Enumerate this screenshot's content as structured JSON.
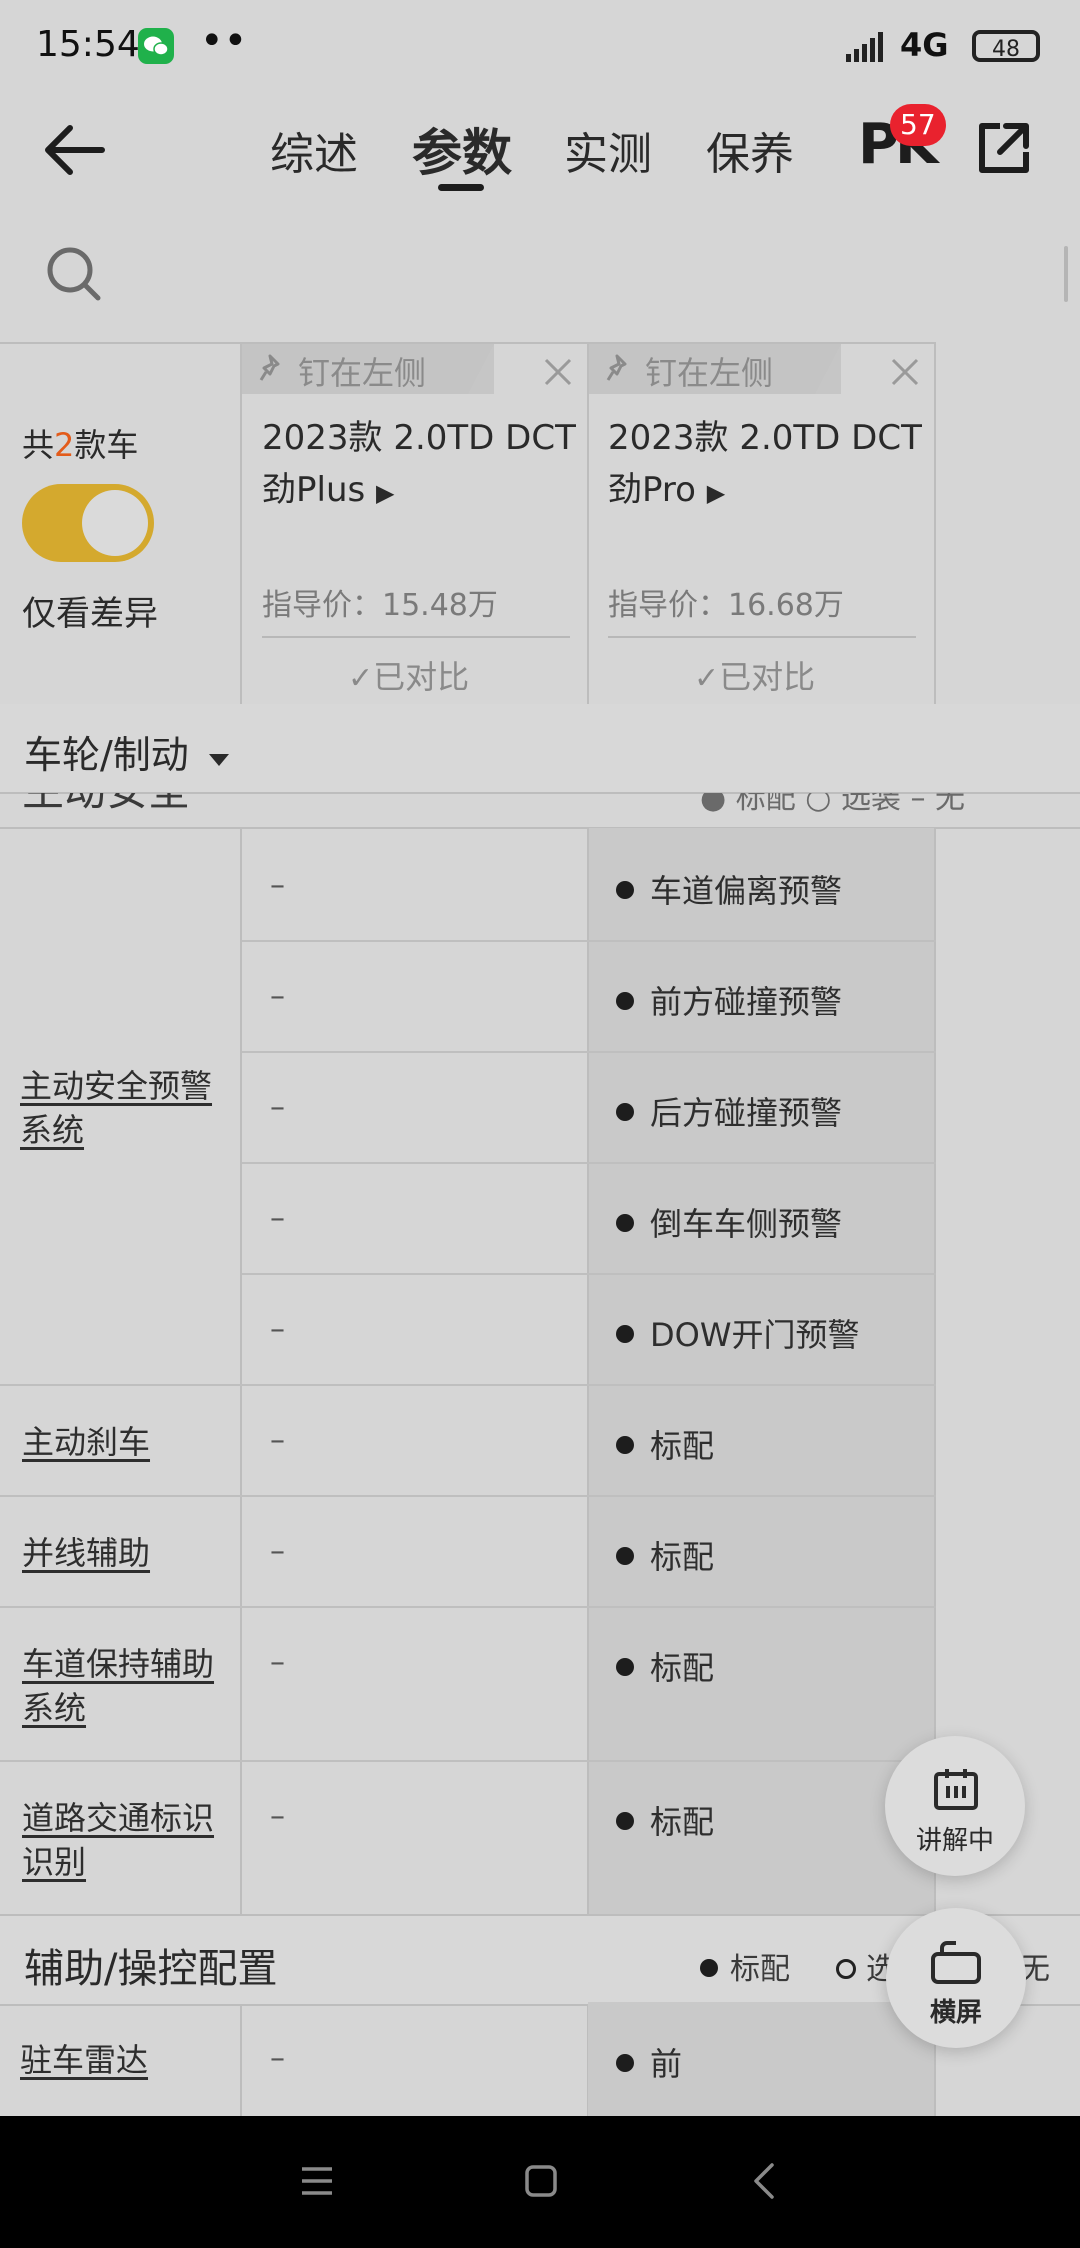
{
  "status": {
    "time": "15:54",
    "network": "4G",
    "battery": "48"
  },
  "nav": {
    "tabs": [
      "综述",
      "参数",
      "实测",
      "保养"
    ],
    "active_tab": "参数",
    "pk_label": "PK",
    "pk_badge": "57"
  },
  "header": {
    "count_prefix": "共",
    "count_num": "2",
    "count_suffix": "款车",
    "diff_toggle_label": "仅看差异",
    "diff_toggle_on": true,
    "cars": [
      {
        "pin_label": "钉在左侧",
        "name_line1": "2023款 2.0TD DCT",
        "name_line2": "劲Plus",
        "price": "指导价：15.48万",
        "compared": "已对比"
      },
      {
        "pin_label": "钉在左侧",
        "name_line1": "2023款 2.0TD DCT",
        "name_line2": "劲Pro",
        "price": "指导价：16.68万",
        "compared": "已对比"
      }
    ]
  },
  "category_selector": "车轮/制动",
  "peek_section": {
    "title": "主动安全",
    "legend": "● 标配   ○ 选装   – 无"
  },
  "rows": [
    {
      "label": "主动安全预警系统",
      "cells": [
        {
          "car1": "–",
          "car2": "车道偏离预警"
        },
        {
          "car1": "–",
          "car2": "前方碰撞预警"
        },
        {
          "car1": "–",
          "car2": "后方碰撞预警"
        },
        {
          "car1": "–",
          "car2": "倒车车侧预警"
        },
        {
          "car1": "–",
          "car2": "DOW开门预警"
        }
      ]
    },
    {
      "label": "主动刹车",
      "cells": [
        {
          "car1": "–",
          "car2": "标配"
        }
      ]
    },
    {
      "label": "并线辅助",
      "cells": [
        {
          "car1": "–",
          "car2": "标配"
        }
      ]
    },
    {
      "label": "车道保持辅助系统",
      "cells": [
        {
          "car1": "–",
          "car2": "标配"
        }
      ]
    },
    {
      "label": "道路交通标识识别",
      "cells": [
        {
          "car1": "–",
          "car2": "标配"
        }
      ]
    }
  ],
  "section2": {
    "title": "辅助/操控配置",
    "legend_standard": "标配",
    "legend_optional": "选",
    "legend_none_tail": "无"
  },
  "row_parking": {
    "label": "驻车雷达",
    "car1": "–",
    "car2": "前"
  },
  "fab": {
    "explain": "讲解中",
    "landscape": "横屏"
  }
}
